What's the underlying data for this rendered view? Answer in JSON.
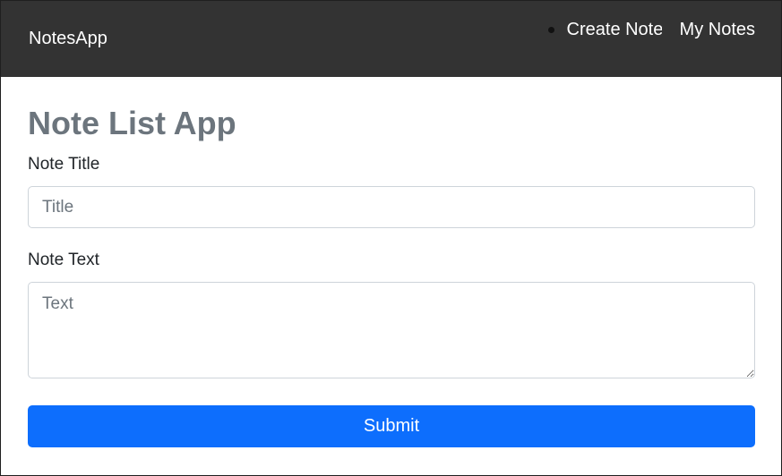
{
  "navbar": {
    "brand": "NotesApp",
    "links": [
      {
        "label": "Create Note"
      },
      {
        "label": "My Notes"
      }
    ]
  },
  "main": {
    "title": "Note List App",
    "title_label": "Note Title",
    "title_placeholder": "Title",
    "text_label": "Note Text",
    "text_placeholder": "Text",
    "submit_label": "Submit"
  },
  "colors": {
    "navbar_bg": "#333333",
    "primary": "#0d6efd",
    "title": "#6c757d"
  }
}
